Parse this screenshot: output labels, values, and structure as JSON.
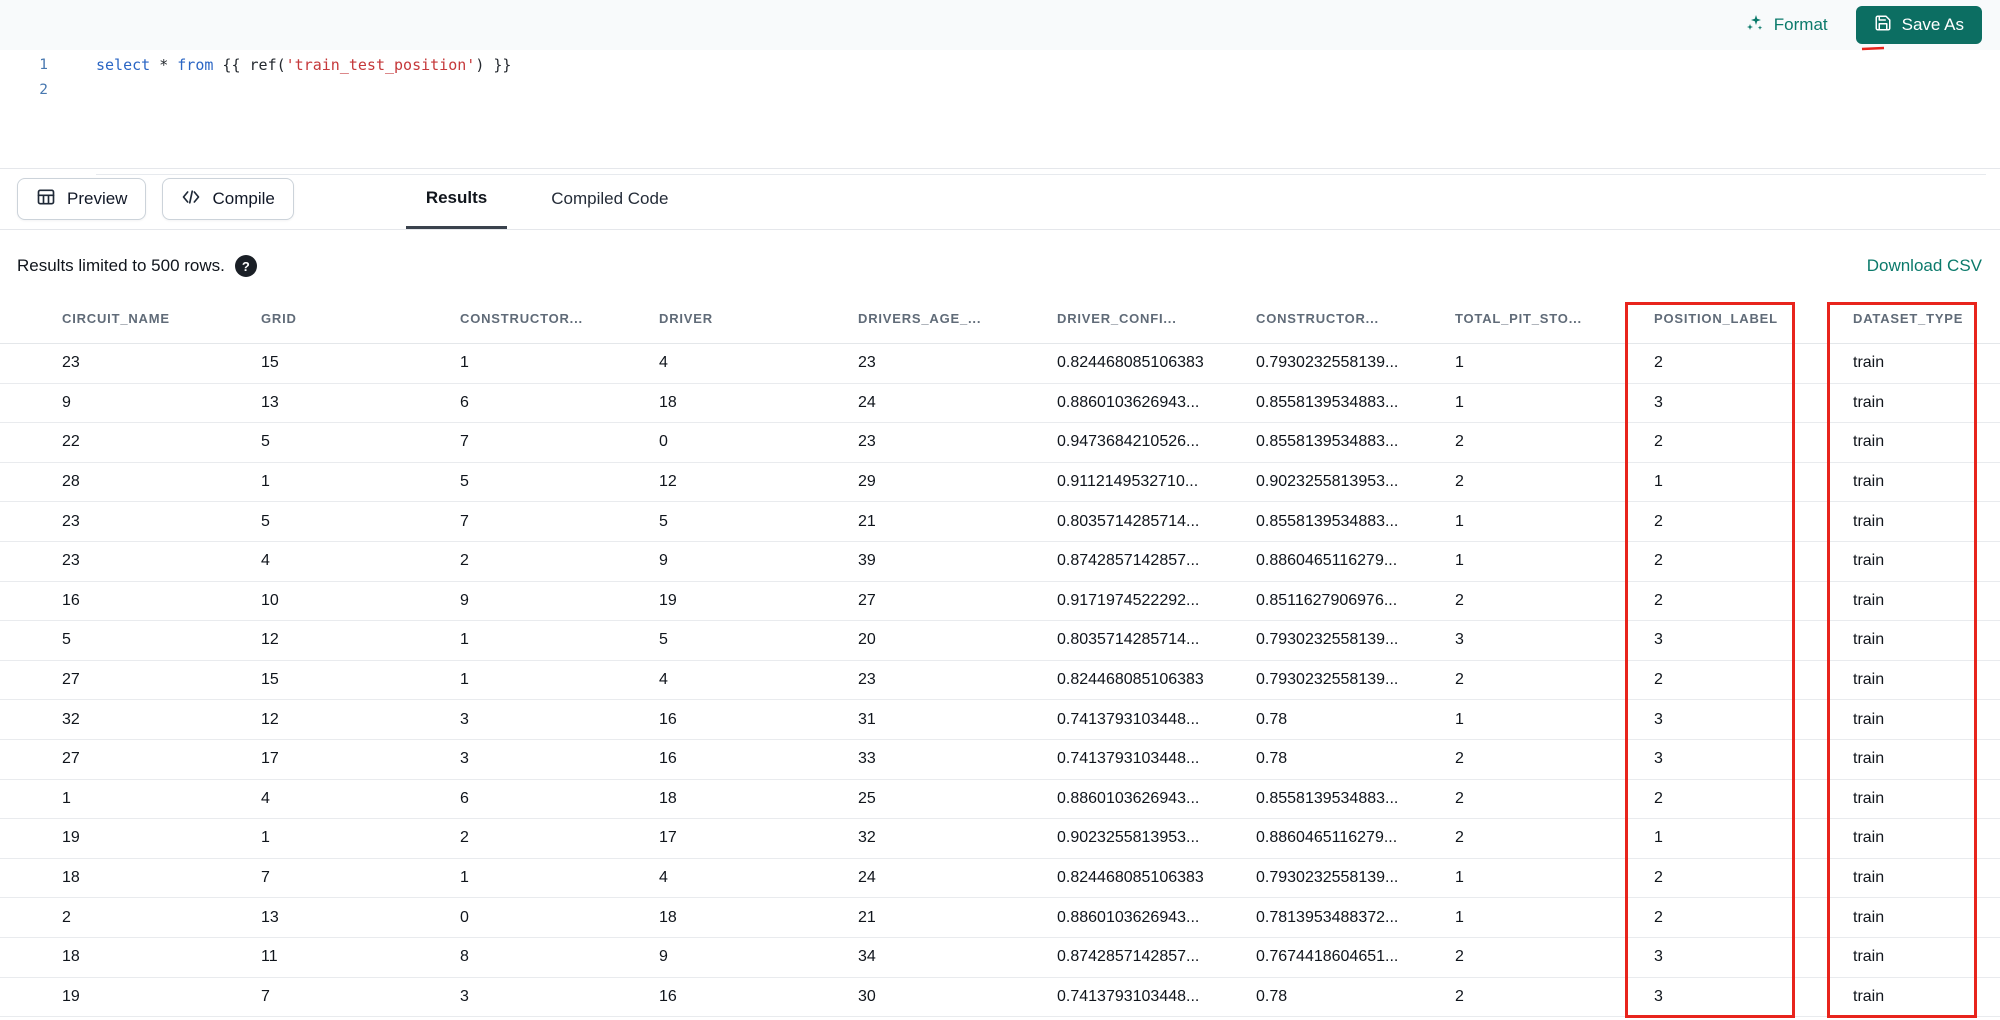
{
  "toolbar": {
    "format_label": "Format",
    "save_as_label": "Save As"
  },
  "editor": {
    "line_numbers": [
      "1",
      "2"
    ],
    "code": {
      "kw_select": "select",
      "star": " * ",
      "kw_from": "from",
      "open_braces": " {{ ",
      "ref_call": "ref(",
      "string_arg": "'train_test_position'",
      "close": ") }}"
    }
  },
  "actions": {
    "preview_label": "Preview",
    "compile_label": "Compile"
  },
  "tabs": [
    {
      "label": "Results"
    },
    {
      "label": "Compiled Code"
    }
  ],
  "results_bar": {
    "limit_text": "Results limited to 500 rows.",
    "help_glyph": "?",
    "download_label": "Download CSV"
  },
  "table": {
    "columns": [
      "CIRCUIT_NAME",
      "GRID",
      "CONSTRUCTOR...",
      "DRIVER",
      "DRIVERS_AGE_...",
      "DRIVER_CONFI...",
      "CONSTRUCTOR...",
      "TOTAL_PIT_STO...",
      "POSITION_LABEL",
      "DATASET_TYPE"
    ],
    "rows": [
      [
        "23",
        "15",
        "1",
        "4",
        "23",
        "0.824468085106383",
        "0.7930232558139...",
        "1",
        "2",
        "train"
      ],
      [
        "9",
        "13",
        "6",
        "18",
        "24",
        "0.8860103626943...",
        "0.8558139534883...",
        "1",
        "3",
        "train"
      ],
      [
        "22",
        "5",
        "7",
        "0",
        "23",
        "0.9473684210526...",
        "0.8558139534883...",
        "2",
        "2",
        "train"
      ],
      [
        "28",
        "1",
        "5",
        "12",
        "29",
        "0.9112149532710...",
        "0.9023255813953...",
        "2",
        "1",
        "train"
      ],
      [
        "23",
        "5",
        "7",
        "5",
        "21",
        "0.8035714285714...",
        "0.8558139534883...",
        "1",
        "2",
        "train"
      ],
      [
        "23",
        "4",
        "2",
        "9",
        "39",
        "0.8742857142857...",
        "0.8860465116279...",
        "1",
        "2",
        "train"
      ],
      [
        "16",
        "10",
        "9",
        "19",
        "27",
        "0.9171974522292...",
        "0.8511627906976...",
        "2",
        "2",
        "train"
      ],
      [
        "5",
        "12",
        "1",
        "5",
        "20",
        "0.8035714285714...",
        "0.7930232558139...",
        "3",
        "3",
        "train"
      ],
      [
        "27",
        "15",
        "1",
        "4",
        "23",
        "0.824468085106383",
        "0.7930232558139...",
        "2",
        "2",
        "train"
      ],
      [
        "32",
        "12",
        "3",
        "16",
        "31",
        "0.7413793103448...",
        "0.78",
        "1",
        "3",
        "train"
      ],
      [
        "27",
        "17",
        "3",
        "16",
        "33",
        "0.7413793103448...",
        "0.78",
        "2",
        "3",
        "train"
      ],
      [
        "1",
        "4",
        "6",
        "18",
        "25",
        "0.8860103626943...",
        "0.8558139534883...",
        "2",
        "2",
        "train"
      ],
      [
        "19",
        "1",
        "2",
        "17",
        "32",
        "0.9023255813953...",
        "0.8860465116279...",
        "2",
        "1",
        "train"
      ],
      [
        "18",
        "7",
        "1",
        "4",
        "24",
        "0.824468085106383",
        "0.7930232558139...",
        "1",
        "2",
        "train"
      ],
      [
        "2",
        "13",
        "0",
        "18",
        "21",
        "0.8860103626943...",
        "0.7813953488372...",
        "1",
        "2",
        "train"
      ],
      [
        "18",
        "11",
        "8",
        "9",
        "34",
        "0.8742857142857...",
        "0.7674418604651...",
        "2",
        "3",
        "train"
      ],
      [
        "19",
        "7",
        "3",
        "16",
        "30",
        "0.7413793103448...",
        "0.78",
        "2",
        "3",
        "train"
      ]
    ]
  },
  "annotations": {
    "highlighted_columns": [
      "POSITION_LABEL",
      "DATASET_TYPE"
    ]
  },
  "colors": {
    "accent_teal": "#0C6E62",
    "link_teal": "#0B7A6B",
    "annotation_red": "#E8241C",
    "keyword_blue": "#2B66C4",
    "string_red": "#C5383A"
  }
}
